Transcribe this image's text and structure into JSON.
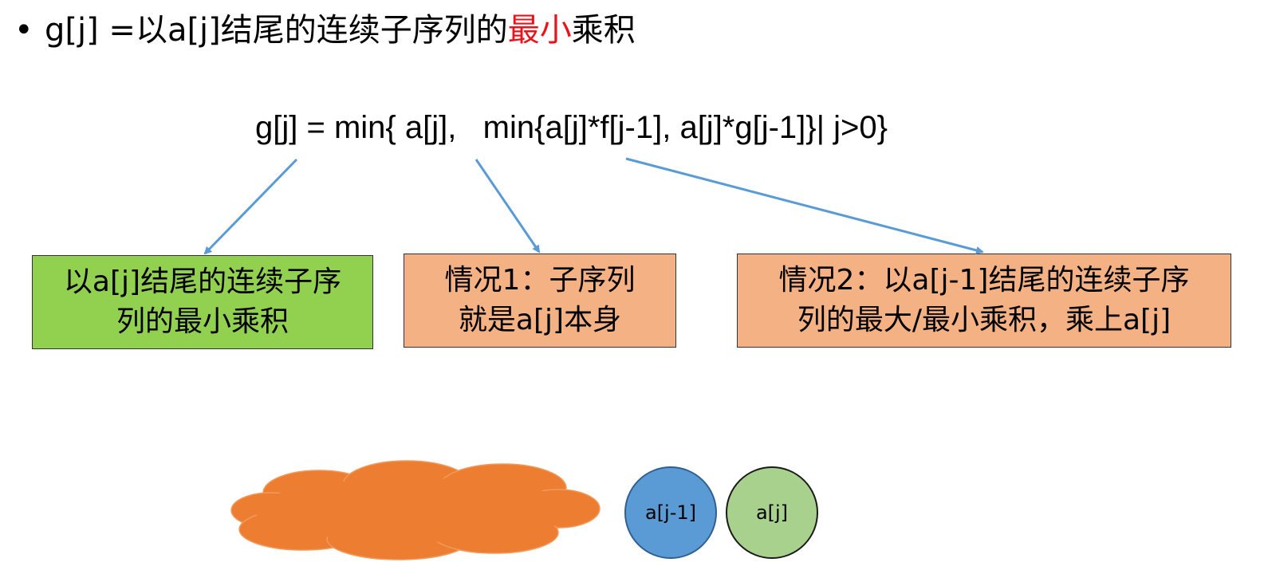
{
  "bullet": {
    "symbol": "•",
    "prefix": "g[j] =以a[j]结尾的连续子序列的",
    "highlight": "最小",
    "suffix": "乘积"
  },
  "formula": {
    "text": "g[j] = min{ a[j],   min{a[j]*f[j-1], a[j]*g[j-1]}| j>0}"
  },
  "boxes": {
    "result": {
      "line1": "以a[j]结尾的连续子序",
      "line2": "列的最小乘积",
      "color": "#92d050"
    },
    "case1": {
      "line1": "情况1：子序列",
      "line2": "就是a[j]本身",
      "color": "#f4b183"
    },
    "case2": {
      "line1": "情况2：以a[j-1]结尾的连续子序",
      "line2": "列的最大/最小乘积，乘上a[j]",
      "color": "#f4b183"
    }
  },
  "illustration": {
    "cloud_color": "#ed7d31",
    "prev": {
      "label": "a[j-1]",
      "color": "#5b9bd5"
    },
    "curr": {
      "label": "a[j]",
      "color": "#a9d18e"
    }
  },
  "arrow_color": "#5b9bd5"
}
